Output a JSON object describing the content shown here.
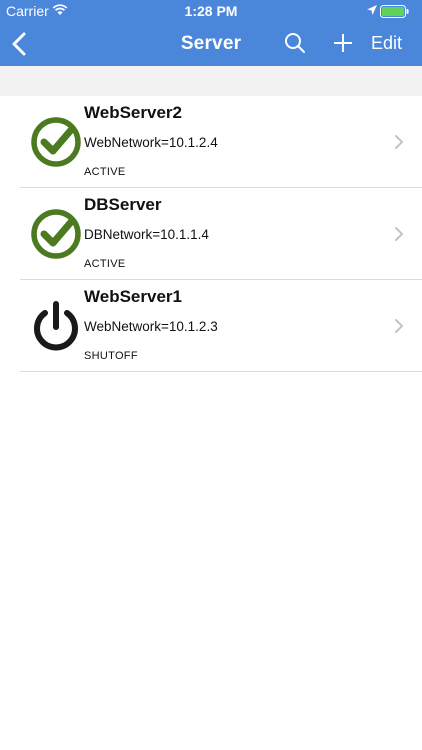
{
  "colors": {
    "nav_bg": "#4a86da",
    "active_green": "#4b7a20",
    "power_black": "#1a1a1a"
  },
  "status_bar": {
    "carrier": "Carrier",
    "time": "1:28 PM",
    "icons": [
      "wifi-icon",
      "location-icon",
      "battery-icon"
    ]
  },
  "nav": {
    "title": "Server",
    "edit_label": "Edit",
    "icons": [
      "back-chevron-icon",
      "search-icon",
      "plus-icon"
    ]
  },
  "servers": [
    {
      "name": "WebServer2",
      "network": "WebNetwork=10.1.2.4",
      "status": "ACTIVE",
      "icon": "check-circle-icon"
    },
    {
      "name": "DBServer",
      "network": "DBNetwork=10.1.1.4",
      "status": "ACTIVE",
      "icon": "check-circle-icon"
    },
    {
      "name": "WebServer1",
      "network": "WebNetwork=10.1.2.3",
      "status": "SHUTOFF",
      "icon": "power-icon"
    }
  ]
}
